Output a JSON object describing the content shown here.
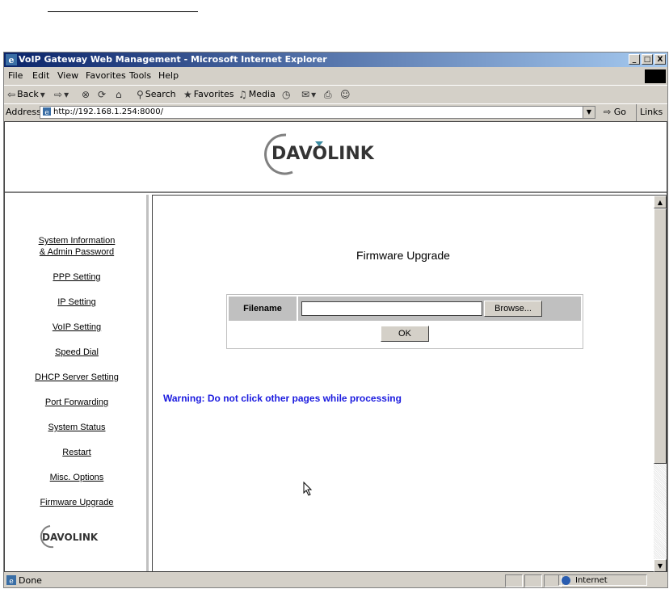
{
  "window": {
    "title": "VoIP Gateway Web Management - Microsoft Internet Explorer",
    "controls": [
      "_",
      "□",
      "X"
    ]
  },
  "menu": [
    "File",
    "Edit",
    "View",
    "Favorites",
    "Tools",
    "Help"
  ],
  "toolbar": {
    "back": "Back",
    "search": "Search",
    "favorites": "Favorites",
    "media": "Media"
  },
  "address": {
    "label": "Address",
    "url": "http://192.168.1.254:8000/",
    "go": "Go",
    "links": "Links"
  },
  "brand": {
    "logo_text": "DAVOLINK"
  },
  "nav": {
    "items": [
      "System Information",
      "& Admin Password",
      "PPP Setting",
      "IP Setting",
      "VoIP Setting",
      "Speed Dial",
      "DHCP Server Setting",
      "Port Forwarding",
      "System Status",
      "Restart",
      "Misc. Options",
      "Firmware Upgrade"
    ]
  },
  "main": {
    "title": "Firmware Upgrade",
    "filename_label": "Filename",
    "browse_label": "Browse...",
    "ok_label": "OK",
    "warning": "Warning: Do not click other pages while processing"
  },
  "status": {
    "text": "Done",
    "zone": "Internet"
  },
  "colors": {
    "title_bar": "#0a246a",
    "warning_text": "#1a1adf",
    "chrome": "#d4d0c8"
  }
}
